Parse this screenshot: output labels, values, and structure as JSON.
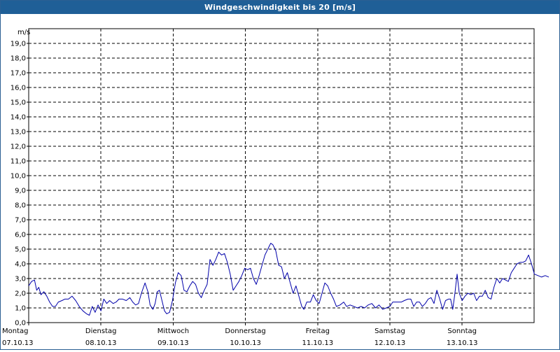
{
  "window": {
    "title": "Windgeschwindigkeit bis 20 [m/s]"
  },
  "chart_data": {
    "type": "line",
    "title": "Windgeschwindigkeit bis 20 [m/s]",
    "ylabel": "m/s",
    "ylim": [
      0,
      20
    ],
    "yticks": [
      "0,0",
      "1,0",
      "2,0",
      "3,0",
      "4,0",
      "5,0",
      "6,0",
      "7,0",
      "8,0",
      "9,0",
      "10,0",
      "11,0",
      "12,0",
      "13,0",
      "14,0",
      "15,0",
      "16,0",
      "17,0",
      "18,0",
      "19,0"
    ],
    "xlim": [
      0,
      7
    ],
    "x_categories": [
      {
        "day": "Montag",
        "date": "07.10.13"
      },
      {
        "day": "Dienstag",
        "date": "08.10.13"
      },
      {
        "day": "Mittwoch",
        "date": "09.10.13"
      },
      {
        "day": "Donnerstag",
        "date": "10.10.13"
      },
      {
        "day": "Freitag",
        "date": "11.10.13"
      },
      {
        "day": "Samstag",
        "date": "12.10.13"
      },
      {
        "day": "Sonntag",
        "date": "13.10.13"
      }
    ],
    "grid": true,
    "series": [
      {
        "color": "#0000aa",
        "points": [
          [
            0.0,
            2.5
          ],
          [
            0.04,
            2.8
          ],
          [
            0.08,
            2.9
          ],
          [
            0.11,
            2.2
          ],
          [
            0.14,
            2.4
          ],
          [
            0.17,
            1.9
          ],
          [
            0.21,
            2.1
          ],
          [
            0.25,
            1.8
          ],
          [
            0.29,
            1.4
          ],
          [
            0.33,
            1.1
          ],
          [
            0.37,
            1.1
          ],
          [
            0.41,
            1.4
          ],
          [
            0.46,
            1.5
          ],
          [
            0.5,
            1.6
          ],
          [
            0.55,
            1.6
          ],
          [
            0.6,
            1.8
          ],
          [
            0.65,
            1.5
          ],
          [
            0.7,
            1.1
          ],
          [
            0.75,
            0.8
          ],
          [
            0.8,
            0.6
          ],
          [
            0.84,
            0.5
          ],
          [
            0.88,
            1.1
          ],
          [
            0.92,
            0.7
          ],
          [
            0.96,
            1.2
          ],
          [
            1.0,
            0.8
          ],
          [
            1.04,
            1.6
          ],
          [
            1.08,
            1.3
          ],
          [
            1.12,
            1.5
          ],
          [
            1.17,
            1.3
          ],
          [
            1.21,
            1.4
          ],
          [
            1.25,
            1.6
          ],
          [
            1.3,
            1.6
          ],
          [
            1.35,
            1.5
          ],
          [
            1.4,
            1.7
          ],
          [
            1.44,
            1.4
          ],
          [
            1.48,
            1.2
          ],
          [
            1.52,
            1.3
          ],
          [
            1.56,
            2.0
          ],
          [
            1.61,
            2.7
          ],
          [
            1.65,
            2.1
          ],
          [
            1.68,
            1.2
          ],
          [
            1.72,
            0.9
          ],
          [
            1.75,
            1.3
          ],
          [
            1.78,
            2.1
          ],
          [
            1.81,
            2.2
          ],
          [
            1.85,
            1.4
          ],
          [
            1.88,
            0.8
          ],
          [
            1.91,
            0.6
          ],
          [
            1.95,
            0.7
          ],
          [
            1.99,
            1.5
          ],
          [
            2.03,
            2.7
          ],
          [
            2.07,
            3.4
          ],
          [
            2.11,
            3.2
          ],
          [
            2.15,
            2.2
          ],
          [
            2.19,
            2.1
          ],
          [
            2.23,
            2.5
          ],
          [
            2.27,
            2.8
          ],
          [
            2.31,
            2.6
          ],
          [
            2.35,
            2.0
          ],
          [
            2.39,
            1.7
          ],
          [
            2.43,
            2.2
          ],
          [
            2.47,
            2.6
          ],
          [
            2.51,
            4.3
          ],
          [
            2.55,
            3.9
          ],
          [
            2.59,
            4.3
          ],
          [
            2.63,
            4.8
          ],
          [
            2.67,
            4.6
          ],
          [
            2.71,
            4.7
          ],
          [
            2.75,
            4.1
          ],
          [
            2.79,
            3.3
          ],
          [
            2.83,
            2.2
          ],
          [
            2.87,
            2.5
          ],
          [
            2.91,
            2.8
          ],
          [
            2.95,
            3.2
          ],
          [
            2.99,
            3.7
          ],
          [
            3.03,
            3.6
          ],
          [
            3.07,
            3.7
          ],
          [
            3.11,
            3.0
          ],
          [
            3.15,
            2.6
          ],
          [
            3.19,
            3.2
          ],
          [
            3.23,
            3.9
          ],
          [
            3.27,
            4.6
          ],
          [
            3.31,
            5.0
          ],
          [
            3.35,
            5.4
          ],
          [
            3.38,
            5.3
          ],
          [
            3.42,
            4.9
          ],
          [
            3.46,
            3.9
          ],
          [
            3.5,
            3.8
          ],
          [
            3.54,
            3.0
          ],
          [
            3.58,
            3.4
          ],
          [
            3.62,
            2.7
          ],
          [
            3.66,
            2.0
          ],
          [
            3.7,
            2.5
          ],
          [
            3.74,
            1.8
          ],
          [
            3.78,
            1.1
          ],
          [
            3.81,
            0.9
          ],
          [
            3.85,
            1.4
          ],
          [
            3.9,
            1.4
          ],
          [
            3.94,
            1.9
          ],
          [
            3.98,
            1.5
          ],
          [
            4.02,
            1.3
          ],
          [
            4.06,
            2.0
          ],
          [
            4.1,
            2.7
          ],
          [
            4.14,
            2.5
          ],
          [
            4.18,
            2.0
          ],
          [
            4.22,
            1.6
          ],
          [
            4.26,
            1.1
          ],
          [
            4.31,
            1.2
          ],
          [
            4.36,
            1.4
          ],
          [
            4.4,
            1.1
          ],
          [
            4.45,
            1.2
          ],
          [
            4.5,
            1.1
          ],
          [
            4.55,
            1.0
          ],
          [
            4.6,
            1.1
          ],
          [
            4.65,
            1.0
          ],
          [
            4.7,
            1.2
          ],
          [
            4.75,
            1.3
          ],
          [
            4.8,
            1.0
          ],
          [
            4.85,
            1.2
          ],
          [
            4.9,
            0.9
          ],
          [
            4.95,
            1.0
          ],
          [
            5.0,
            1.1
          ],
          [
            5.04,
            1.4
          ],
          [
            5.1,
            1.4
          ],
          [
            5.16,
            1.4
          ],
          [
            5.2,
            1.5
          ],
          [
            5.25,
            1.6
          ],
          [
            5.29,
            1.6
          ],
          [
            5.33,
            1.1
          ],
          [
            5.37,
            1.4
          ],
          [
            5.41,
            1.4
          ],
          [
            5.45,
            1.1
          ],
          [
            5.49,
            1.3
          ],
          [
            5.53,
            1.6
          ],
          [
            5.57,
            1.7
          ],
          [
            5.61,
            1.3
          ],
          [
            5.65,
            2.2
          ],
          [
            5.69,
            1.6
          ],
          [
            5.73,
            0.9
          ],
          [
            5.77,
            1.5
          ],
          [
            5.81,
            1.6
          ],
          [
            5.84,
            1.6
          ],
          [
            5.87,
            0.9
          ],
          [
            5.9,
            2.0
          ],
          [
            5.93,
            3.3
          ],
          [
            5.96,
            2.0
          ],
          [
            6.0,
            1.5
          ],
          [
            6.04,
            1.8
          ],
          [
            6.08,
            2.0
          ],
          [
            6.12,
            1.9
          ],
          [
            6.16,
            2.0
          ],
          [
            6.2,
            1.5
          ],
          [
            6.24,
            1.8
          ],
          [
            6.28,
            1.8
          ],
          [
            6.32,
            2.2
          ],
          [
            6.36,
            1.7
          ],
          [
            6.4,
            1.6
          ],
          [
            6.44,
            2.4
          ],
          [
            6.48,
            3.0
          ],
          [
            6.52,
            2.7
          ],
          [
            6.56,
            3.0
          ],
          [
            6.6,
            2.9
          ],
          [
            6.64,
            2.8
          ],
          [
            6.68,
            3.4
          ],
          [
            6.72,
            3.7
          ],
          [
            6.76,
            4.0
          ],
          [
            6.8,
            4.1
          ],
          [
            6.84,
            4.1
          ],
          [
            6.88,
            4.2
          ],
          [
            6.92,
            4.6
          ],
          [
            6.96,
            4.0
          ],
          [
            7.0,
            3.3
          ],
          [
            7.05,
            3.2
          ],
          [
            7.1,
            3.1
          ],
          [
            7.15,
            3.2
          ],
          [
            7.2,
            3.1
          ]
        ]
      }
    ]
  }
}
